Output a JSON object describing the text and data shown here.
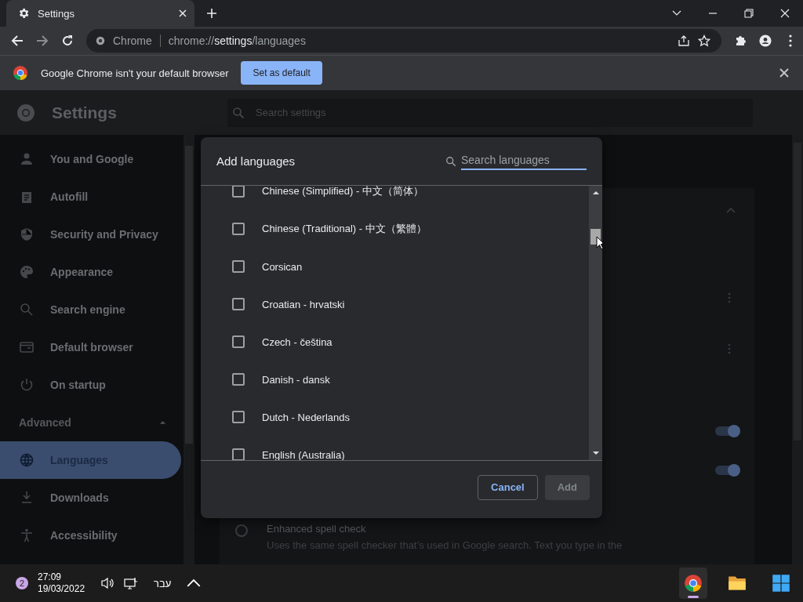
{
  "tab": {
    "title": "Settings",
    "selected": true
  },
  "toolbar": {
    "site_label": "Chrome",
    "url_host": "chrome://",
    "url_bold": "settings",
    "url_path": "/languages"
  },
  "infobar": {
    "message": "Google Chrome isn't your default browser",
    "button": "Set as default"
  },
  "header": {
    "title": "Settings",
    "search": {
      "placeholder": "Search settings"
    }
  },
  "sidebar": {
    "items": [
      {
        "label": "You and Google",
        "kind": "person",
        "selected": false
      },
      {
        "label": "Autofill",
        "kind": "clipboard",
        "selected": false
      },
      {
        "label": "Security and Privacy",
        "kind": "shield",
        "selected": false
      },
      {
        "label": "Appearance",
        "kind": "palette",
        "selected": false
      },
      {
        "label": "Search engine",
        "kind": "search",
        "selected": false
      },
      {
        "label": "Default browser",
        "kind": "browser",
        "selected": false
      },
      {
        "label": "On startup",
        "kind": "power",
        "selected": false
      }
    ],
    "advanced": {
      "label": "Advanced",
      "expanded": true
    },
    "advanced_items": [
      {
        "label": "Languages",
        "kind": "globe",
        "selected": true
      },
      {
        "label": "Downloads",
        "kind": "download",
        "selected": false
      },
      {
        "label": "Accessibility",
        "kind": "accessibility",
        "selected": false
      }
    ]
  },
  "content": {
    "toggles": [
      {
        "on": true
      },
      {
        "on": true
      }
    ],
    "spell_option": {
      "title": "Enhanced spell check",
      "description": "Uses the same spell checker that’s used in Google search. Text you type in the",
      "selected": false
    }
  },
  "dialog": {
    "title": "Add languages",
    "search": {
      "placeholder": "Search languages"
    },
    "languages": [
      {
        "label": "Chinese (Simplified) - 中文（简体）",
        "checked": false
      },
      {
        "label": "Chinese (Traditional) - 中文（繁體）",
        "checked": false
      },
      {
        "label": "Corsican",
        "checked": false
      },
      {
        "label": "Croatian - hrvatski",
        "checked": false
      },
      {
        "label": "Czech - čeština",
        "checked": false
      },
      {
        "label": "Danish - dansk",
        "checked": false
      },
      {
        "label": "Dutch - Nederlands",
        "checked": false
      },
      {
        "label": "English (Australia)",
        "checked": false
      }
    ],
    "buttons": [
      {
        "label": "Cancel",
        "kind": "secondary",
        "disabled": false
      },
      {
        "label": "Add",
        "kind": "primary",
        "disabled": true
      }
    ]
  },
  "taskbar": {
    "badge": "2",
    "time": "27:09",
    "date": "19/03/2022",
    "language": "עבר",
    "apps": [
      {
        "kind": "chrome",
        "active": true
      },
      {
        "kind": "folder",
        "active": false
      },
      {
        "kind": "windows",
        "active": false
      }
    ]
  }
}
